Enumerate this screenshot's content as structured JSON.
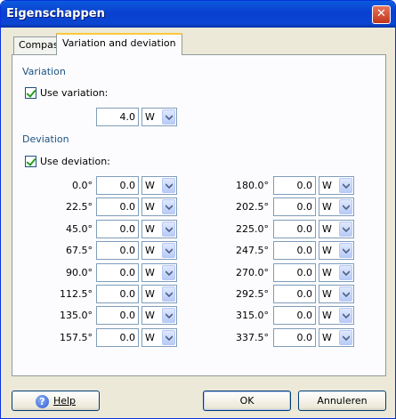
{
  "window": {
    "title": "Eigenschappen",
    "close_glyph": "✕"
  },
  "tabs": [
    {
      "label": "Compas",
      "active": false
    },
    {
      "label": "Variation and deviation",
      "active": true
    }
  ],
  "variation": {
    "group_label": "Variation",
    "use_label": "Use variation:",
    "checked": true,
    "value": "4.0",
    "direction": "W"
  },
  "deviation": {
    "group_label": "Deviation",
    "use_label": "Use deviation:",
    "checked": true,
    "rows_left": [
      {
        "heading": "0.0°",
        "value": "0.0",
        "dir": "W"
      },
      {
        "heading": "22.5°",
        "value": "0.0",
        "dir": "W"
      },
      {
        "heading": "45.0°",
        "value": "0.0",
        "dir": "W"
      },
      {
        "heading": "67.5°",
        "value": "0.0",
        "dir": "W"
      },
      {
        "heading": "90.0°",
        "value": "0.0",
        "dir": "W"
      },
      {
        "heading": "112.5°",
        "value": "0.0",
        "dir": "W"
      },
      {
        "heading": "135.0°",
        "value": "0.0",
        "dir": "W"
      },
      {
        "heading": "157.5°",
        "value": "0.0",
        "dir": "W"
      }
    ],
    "rows_right": [
      {
        "heading": "180.0°",
        "value": "0.0",
        "dir": "W"
      },
      {
        "heading": "202.5°",
        "value": "0.0",
        "dir": "W"
      },
      {
        "heading": "225.0°",
        "value": "0.0",
        "dir": "W"
      },
      {
        "heading": "247.5°",
        "value": "0.0",
        "dir": "W"
      },
      {
        "heading": "270.0°",
        "value": "0.0",
        "dir": "W"
      },
      {
        "heading": "292.5°",
        "value": "0.0",
        "dir": "W"
      },
      {
        "heading": "315.0°",
        "value": "0.0",
        "dir": "W"
      },
      {
        "heading": "337.5°",
        "value": "0.0",
        "dir": "W"
      }
    ]
  },
  "buttons": {
    "help": "Help",
    "ok": "OK",
    "cancel": "Annuleren"
  },
  "icons": {
    "help": "help-icon",
    "close": "close-icon",
    "check": "checkmark-icon",
    "dropdown": "chevron-down-icon"
  },
  "colors": {
    "title_bar": "#0a47d3",
    "group_label": "#1c5180",
    "check_mark": "#21a121",
    "tab_highlight": "#ffc83c"
  }
}
